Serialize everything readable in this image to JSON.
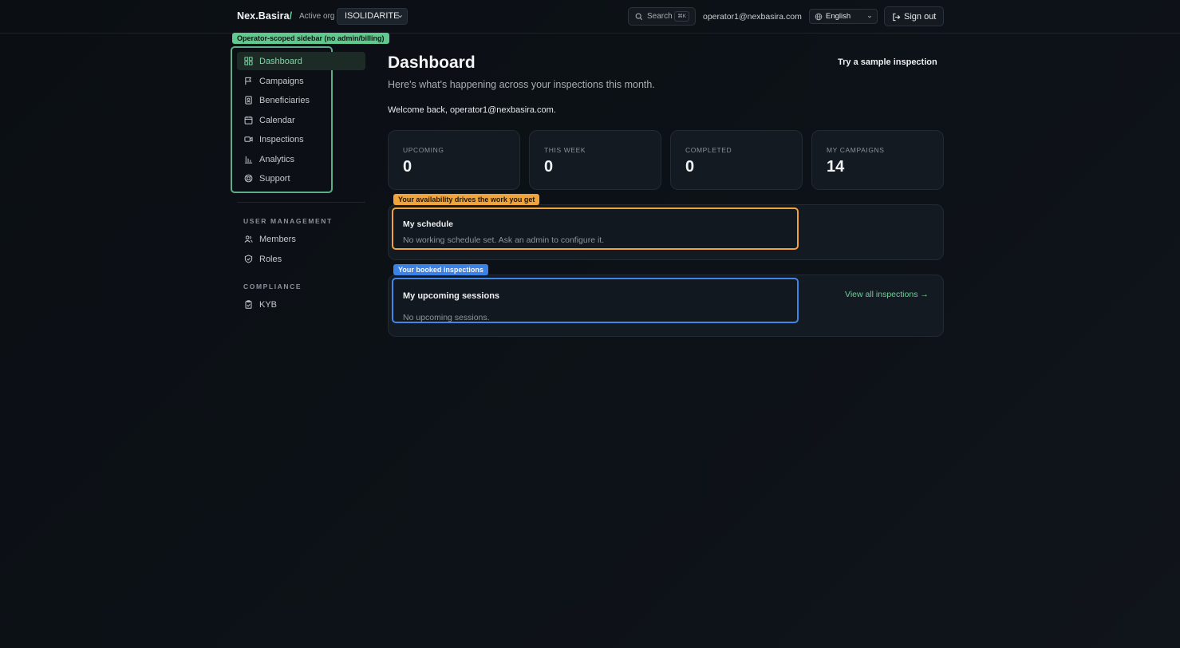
{
  "header": {
    "brand": "Nex.Basira",
    "brand_slash": "/",
    "active_org_label": "Active org",
    "org_value": "ISOLIDARITE",
    "search_label": "Search",
    "search_shortcut": "⌘K",
    "user_email": "operator1@nexbasira.com",
    "language": "English",
    "signout_label": "Sign out"
  },
  "sidebar": {
    "annotation": "Operator-scoped sidebar (no admin/billing)",
    "items": [
      {
        "label": "Dashboard",
        "icon": "grid-icon",
        "active": true
      },
      {
        "label": "Campaigns",
        "icon": "flag-icon"
      },
      {
        "label": "Beneficiaries",
        "icon": "id-badge-icon"
      },
      {
        "label": "Calendar",
        "icon": "calendar-icon"
      },
      {
        "label": "Inspections",
        "icon": "video-icon"
      },
      {
        "label": "Analytics",
        "icon": "bar-chart-icon"
      },
      {
        "label": "Support",
        "icon": "lifebuoy-icon"
      }
    ],
    "user_management_label": "USER MANAGEMENT",
    "user_management": [
      {
        "label": "Members",
        "icon": "users-icon"
      },
      {
        "label": "Roles",
        "icon": "shield-icon"
      }
    ],
    "compliance_label": "COMPLIANCE",
    "compliance": [
      {
        "label": "KYB",
        "icon": "clipboard-check-icon"
      }
    ]
  },
  "main": {
    "title": "Dashboard",
    "subtitle": "Here's what's happening across your inspections this month.",
    "welcome": "Welcome back, operator1@nexbasira.com.",
    "sample_button": "Try a sample inspection",
    "stats": [
      {
        "label": "UPCOMING",
        "value": "0"
      },
      {
        "label": "THIS WEEK",
        "value": "0"
      },
      {
        "label": "COMPLETED",
        "value": "0"
      },
      {
        "label": "MY CAMPAIGNS",
        "value": "14"
      }
    ],
    "schedule": {
      "annotation": "Your availability drives the work you get",
      "title": "My schedule",
      "text": "No working schedule set. Ask an admin to configure it."
    },
    "sessions": {
      "annotation": "Your booked inspections",
      "title": "My upcoming sessions",
      "text": "No upcoming sessions.",
      "view_all": "View all inspections →"
    }
  },
  "colors": {
    "accent_green": "#6fd19a",
    "annotation_orange": "#f0a33a",
    "annotation_blue": "#3b82e6"
  }
}
